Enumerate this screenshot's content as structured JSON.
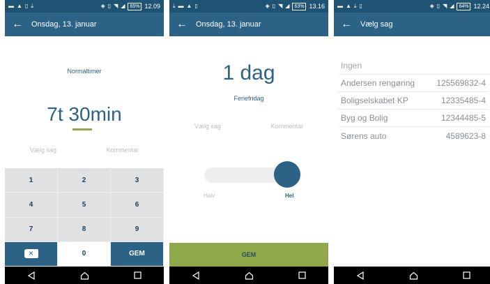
{
  "screens": [
    {
      "status": {
        "time": "12.09",
        "battery": "65%"
      },
      "title": "Onsdag, 13. januar",
      "hours_label": "Normaltimer",
      "duration": "7t 30min",
      "choose_case": "Vælg sag",
      "comment": "Kommentar",
      "keys": [
        "1",
        "2",
        "3",
        "4",
        "5",
        "6",
        "7",
        "8",
        "9",
        "0",
        "GEM"
      ]
    },
    {
      "status": {
        "time": "13.16",
        "battery": "63%"
      },
      "title": "Onsdag, 13. januar",
      "days": "1 dag",
      "day_type": "Feriefridag",
      "choose_case": "Vælg sag",
      "comment": "Kommentar",
      "toggle": {
        "left_label": "Halv",
        "right_label": "Hel",
        "selected": "Hel"
      },
      "save": "GEM"
    },
    {
      "status": {
        "time": "12.24",
        "battery": "64%"
      },
      "title": "Vælg sag",
      "cases": [
        {
          "name": "Ingen",
          "number": ""
        },
        {
          "name": "Andersen rengøring",
          "number": "125569832-4"
        },
        {
          "name": "Boligselskabet KP",
          "number": "12335485-4"
        },
        {
          "name": "Byg og Bolig",
          "number": "12344485-5"
        },
        {
          "name": "Sørens auto",
          "number": "4589623-8"
        }
      ]
    }
  ],
  "theme": {
    "primary": "#2b6286",
    "statusbar": "#1f5373",
    "accent": "#8fa84a"
  },
  "icons": [
    "back-arrow-icon",
    "backspace-icon",
    "nav-back-icon",
    "nav-home-icon",
    "nav-recents-icon",
    "wifi-icon",
    "signal-icon",
    "vibrate-icon"
  ]
}
